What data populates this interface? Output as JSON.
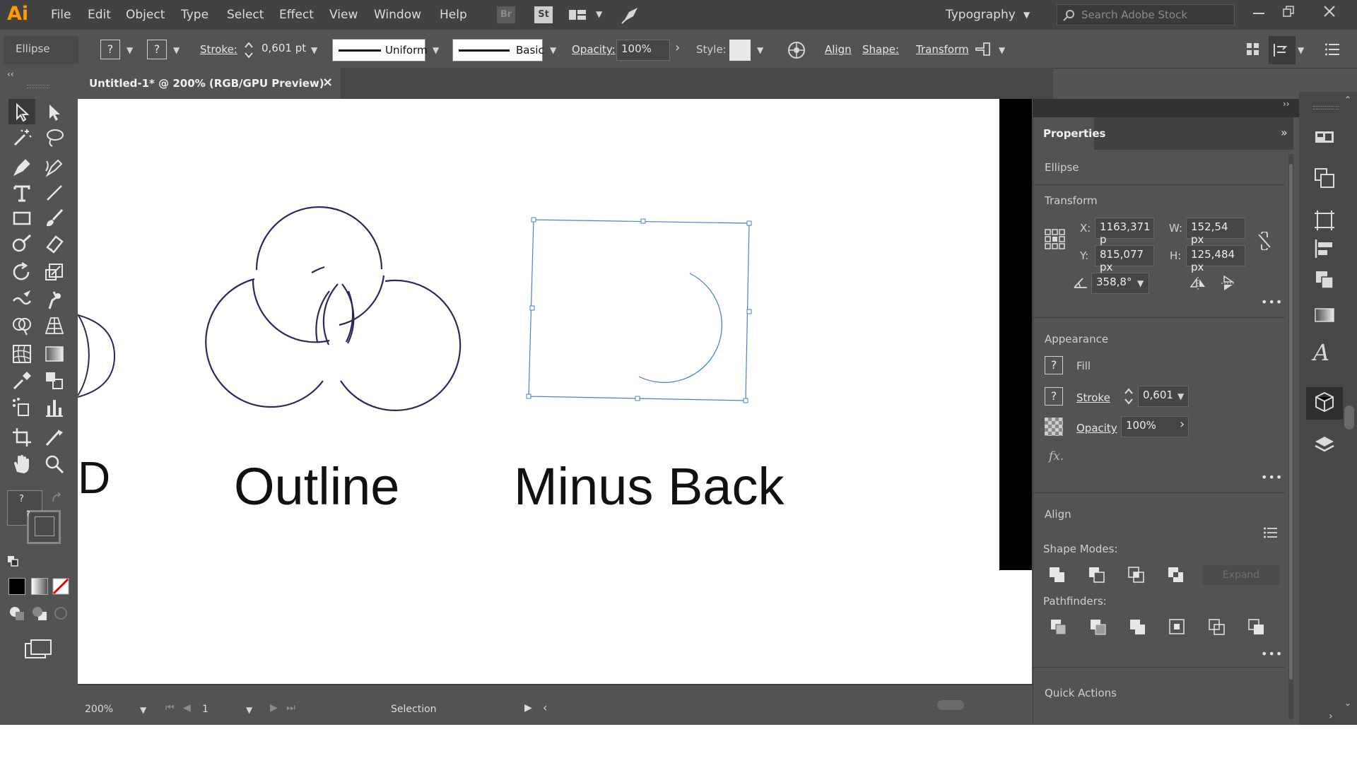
{
  "app": {
    "logo": "Ai",
    "workspace": "Typography",
    "search_placeholder": "Search Adobe Stock"
  },
  "menu": [
    "File",
    "Edit",
    "Object",
    "Type",
    "Select",
    "Effect",
    "View",
    "Window",
    "Help"
  ],
  "menu_badges": {
    "bridge": "Br",
    "stock": "St"
  },
  "control_bar": {
    "selection_type": "Ellipse",
    "fill_box": "?",
    "stroke_box": "?",
    "stroke_label": "Stroke:",
    "stroke_value": "0,601 pt",
    "profile_label": "Uniform",
    "brush_label": "Basic",
    "opacity_label": "Opacity:",
    "opacity_value": "100%",
    "style_label": "Style:",
    "align_label": "Align",
    "shape_label": "Shape:",
    "transform_label": "Transform"
  },
  "document_tab": {
    "title": "Untitled-1* @ 200% (RGB/GPU Preview)",
    "close": "×"
  },
  "canvas": {
    "label_left_partial": "D",
    "label_outline": "Outline",
    "label_minus_back": "Minus Back"
  },
  "status_bar": {
    "zoom": "200%",
    "artboard": "1",
    "tool": "Selection"
  },
  "properties": {
    "title": "Properties",
    "object_type": "Ellipse",
    "transform": {
      "label": "Transform",
      "x_label": "X:",
      "x": "1163,371 p",
      "y_label": "Y:",
      "y": "815,077 px",
      "w_label": "W:",
      "w": "152,54 px",
      "h_label": "H:",
      "h": "125,484 px",
      "angle": "358,8°"
    },
    "appearance": {
      "label": "Appearance",
      "fill_label": "Fill",
      "fill_box": "?",
      "stroke_label": "Stroke",
      "stroke_box": "?",
      "stroke_value": "0,601",
      "opacity_label": "Opacity",
      "opacity_value": "100%",
      "fx": "fx."
    },
    "align_label": "Align",
    "shape_modes_label": "Shape Modes:",
    "expand_label": "Expand",
    "pathfinders_label": "Pathfinders:",
    "quick_actions_label": "Quick Actions"
  },
  "colors": {
    "ui_dark": "#424242",
    "ui_mid": "#535353",
    "stroke_navy": "#2a2a5a",
    "selection_blue": "#4a7fd0",
    "logo_orange": "#ff9a00"
  }
}
